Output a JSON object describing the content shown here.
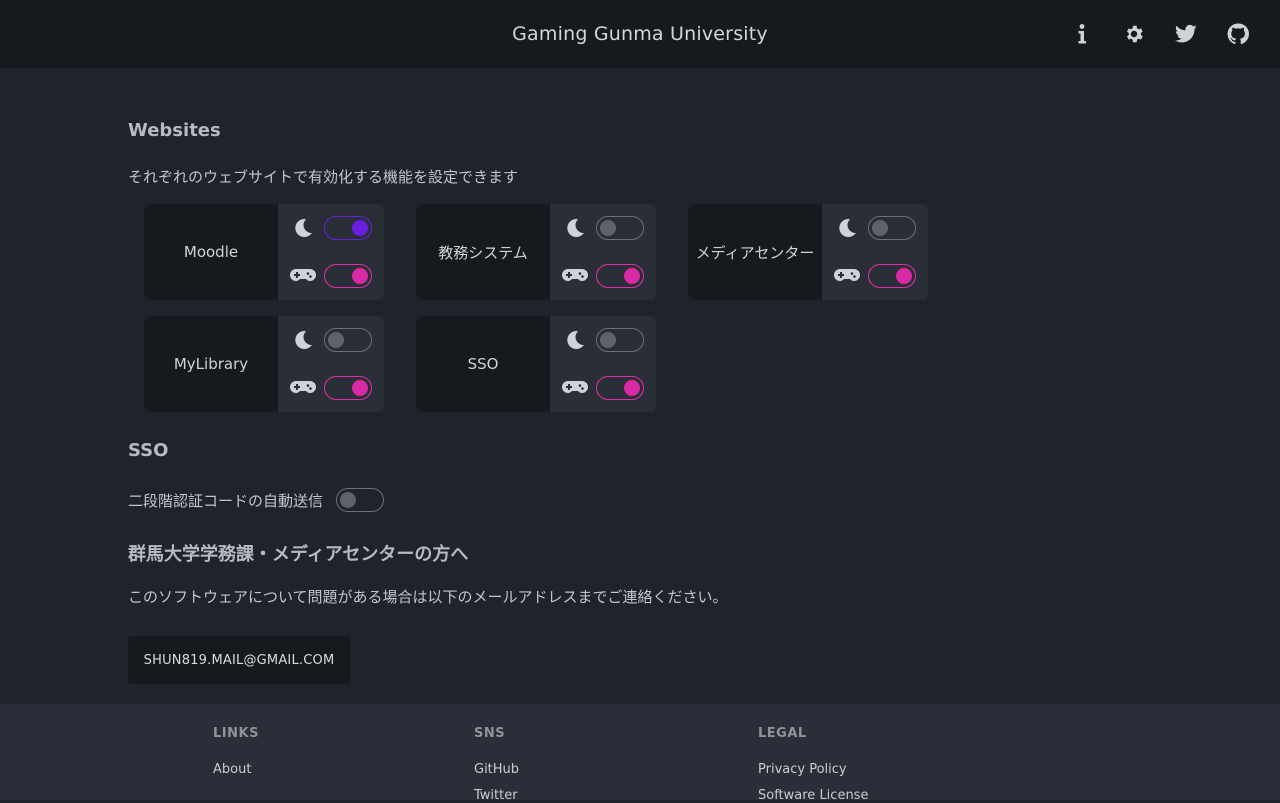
{
  "header": {
    "title": "Gaming Gunma University",
    "icons": [
      "info-icon",
      "gear-icon",
      "twitter-icon",
      "github-icon"
    ]
  },
  "websites": {
    "title": "Websites",
    "description": "それぞれのウェブサイトで有効化する機能を設定できます",
    "cards": [
      {
        "name": "Moodle",
        "dark_mode": true,
        "gaming": true
      },
      {
        "name": "教務システム",
        "dark_mode": false,
        "gaming": true
      },
      {
        "name": "メディアセンター",
        "dark_mode": false,
        "gaming": true
      },
      {
        "name": "MyLibrary",
        "dark_mode": false,
        "gaming": true
      },
      {
        "name": "SSO",
        "dark_mode": false,
        "gaming": true
      }
    ]
  },
  "sso": {
    "title": "SSO",
    "auto_send_label": "二段階認証コードの自動送信",
    "auto_send": false
  },
  "contact": {
    "title": "群馬大学学務課・メディアセンターの方へ",
    "description": "このソフトウェアについて問題がある場合は以下のメールアドレスまでご連絡ください。",
    "email": "SHUN819.MAIL@GMAIL.COM"
  },
  "footer": {
    "links": {
      "heading": "LINKS",
      "items": [
        "About"
      ]
    },
    "sns": {
      "heading": "SNS",
      "items": [
        "GitHub",
        "Twitter"
      ]
    },
    "legal": {
      "heading": "LEGAL",
      "items": [
        "Privacy Policy",
        "Software License"
      ]
    }
  },
  "colors": {
    "background": "#1f232b",
    "header": "#16191e",
    "toggle_purple": "#6a1ee0",
    "toggle_pink": "#d92aa6"
  }
}
